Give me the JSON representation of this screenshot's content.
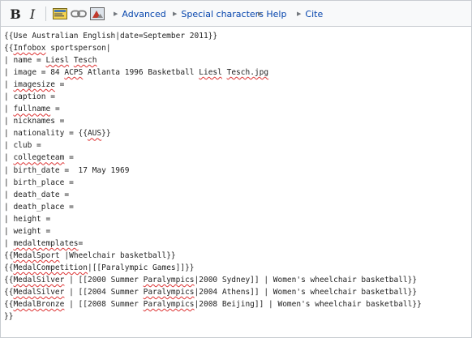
{
  "toolbar": {
    "bold_label": "B",
    "italic_label": "I",
    "embed_icon": "embedded-file-icon",
    "link_icon": "link-icon",
    "media_icon": "media-icon",
    "menus": {
      "advanced": "Advanced",
      "special_characters": "Special characters",
      "help": "Help",
      "cite": "Cite"
    }
  },
  "editor": {
    "lines": [
      [
        {
          "t": "{{Use Australian English|date=September 2011}}"
        }
      ],
      [
        {
          "t": "{{"
        },
        {
          "t": "Infobox",
          "s": true
        },
        {
          "t": " sportsperson|"
        }
      ],
      [
        {
          "t": "| name = "
        },
        {
          "t": "Liesl",
          "s": true
        },
        {
          "t": " "
        },
        {
          "t": "Tesch",
          "s": true
        }
      ],
      [
        {
          "t": "| image = 84 "
        },
        {
          "t": "ACPS",
          "s": true
        },
        {
          "t": " Atlanta 1996 Basketball "
        },
        {
          "t": "Liesl",
          "s": true
        },
        {
          "t": " "
        },
        {
          "t": "Tesch.jpg",
          "s": true
        }
      ],
      [
        {
          "t": "| "
        },
        {
          "t": "imagesize",
          "s": true
        },
        {
          "t": " ="
        }
      ],
      [
        {
          "t": "| caption ="
        }
      ],
      [
        {
          "t": "| "
        },
        {
          "t": "fullname",
          "s": true
        },
        {
          "t": " ="
        }
      ],
      [
        {
          "t": "| nicknames ="
        }
      ],
      [
        {
          "t": "| nationality = {{"
        },
        {
          "t": "AUS",
          "s": true
        },
        {
          "t": "}}"
        }
      ],
      [
        {
          "t": "| club ="
        }
      ],
      [
        {
          "t": "| "
        },
        {
          "t": "collegeteam",
          "s": true
        },
        {
          "t": " ="
        }
      ],
      [
        {
          "t": "| birth_date =  17 May 1969"
        }
      ],
      [
        {
          "t": "| birth_place ="
        }
      ],
      [
        {
          "t": "| death_date ="
        }
      ],
      [
        {
          "t": "| death_place ="
        }
      ],
      [
        {
          "t": "| height ="
        }
      ],
      [
        {
          "t": "| weight ="
        }
      ],
      [
        {
          "t": "| "
        },
        {
          "t": "medaltemplates",
          "s": true
        },
        {
          "t": "="
        }
      ],
      [
        {
          "t": "{{"
        },
        {
          "t": "MedalSport",
          "s": true
        },
        {
          "t": " |Wheelchair basketball}}"
        }
      ],
      [
        {
          "t": "{{"
        },
        {
          "t": "MedalCompetition",
          "s": true
        },
        {
          "t": "|[[Paralympic Games]]}}"
        }
      ],
      [
        {
          "t": "{{"
        },
        {
          "t": "MedalSilver",
          "s": true
        },
        {
          "t": " | [[2000 Summer "
        },
        {
          "t": "Paralympics",
          "s": true
        },
        {
          "t": "|2000 Sydney]] | Women's wheelchair basketball}}"
        }
      ],
      [
        {
          "t": "{{"
        },
        {
          "t": "MedalSilver",
          "s": true
        },
        {
          "t": " | [[2004 Summer "
        },
        {
          "t": "Paralympics",
          "s": true
        },
        {
          "t": "|2004 Athens]] | Women's wheelchair basketball}}"
        }
      ],
      [
        {
          "t": "{{"
        },
        {
          "t": "MedalBronze",
          "s": true
        },
        {
          "t": " | [[2008 Summer "
        },
        {
          "t": "Paralympics",
          "s": true
        },
        {
          "t": "|2008 Beijing]] | Women's wheelchair basketball}}"
        }
      ],
      [
        {
          "t": "}}"
        }
      ]
    ]
  },
  "colors": {
    "link": "#0645ad",
    "squiggle": "#dd3333",
    "toolbar_bg": "#f8f9fa",
    "border": "#c8ccd1"
  }
}
